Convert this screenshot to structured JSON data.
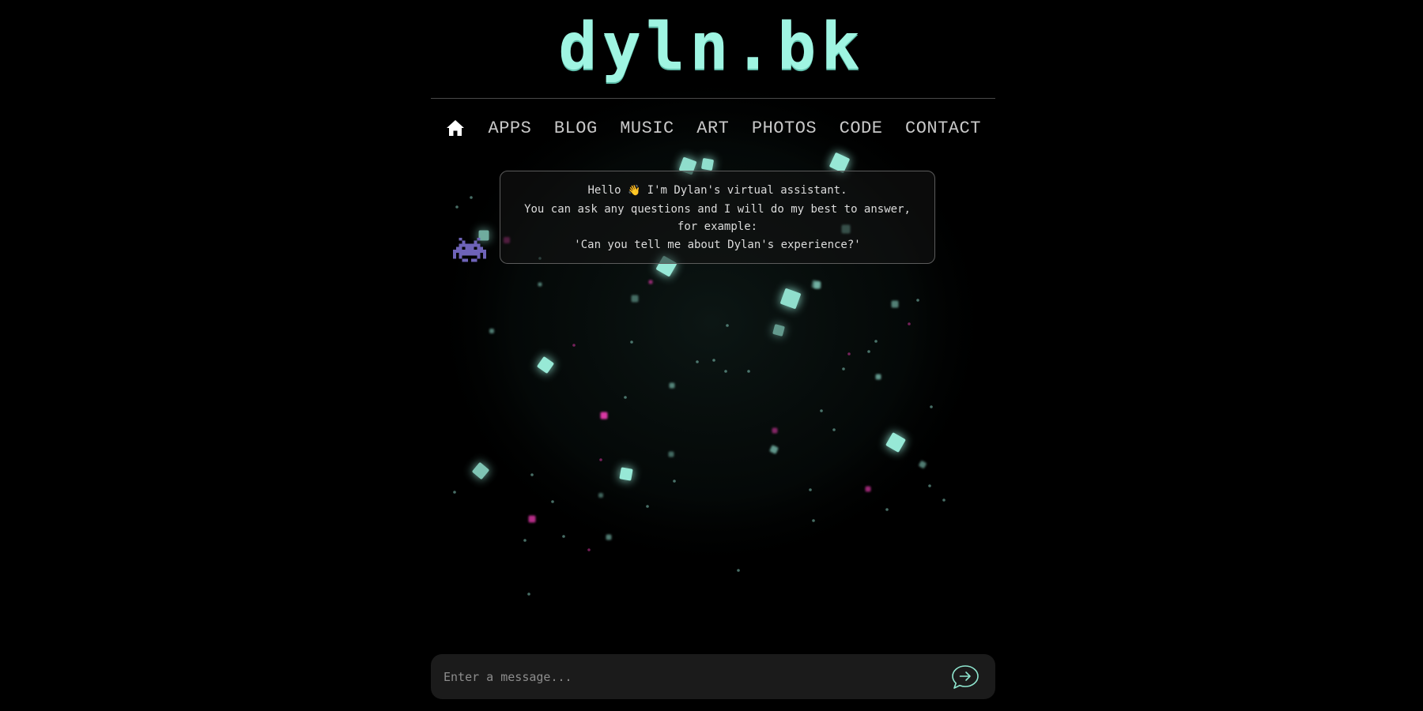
{
  "site": {
    "title": "dyln.bk",
    "accent_color": "#9ff5e2",
    "secondary_accent": "#ff3fbf"
  },
  "nav": {
    "home_icon": "home-icon",
    "items": [
      {
        "label": "APPS"
      },
      {
        "label": "BLOG"
      },
      {
        "label": "MUSIC"
      },
      {
        "label": "ART"
      },
      {
        "label": "PHOTOS"
      },
      {
        "label": "CODE"
      },
      {
        "label": "CONTACT"
      }
    ]
  },
  "chat": {
    "assistant_icon": "space-invader-icon",
    "greeting": {
      "line1_before": "Hello ",
      "line1_emoji": "👋",
      "line1_after": " I'm Dylan's virtual assistant.",
      "line2": "You can ask any questions and I will do my best to answer,",
      "line3": "for example:",
      "line4": "'Can you tell me about Dylan's experience?'"
    }
  },
  "composer": {
    "placeholder": "Enter a message...",
    "value": "",
    "send_icon": "send-arrow-icon"
  }
}
